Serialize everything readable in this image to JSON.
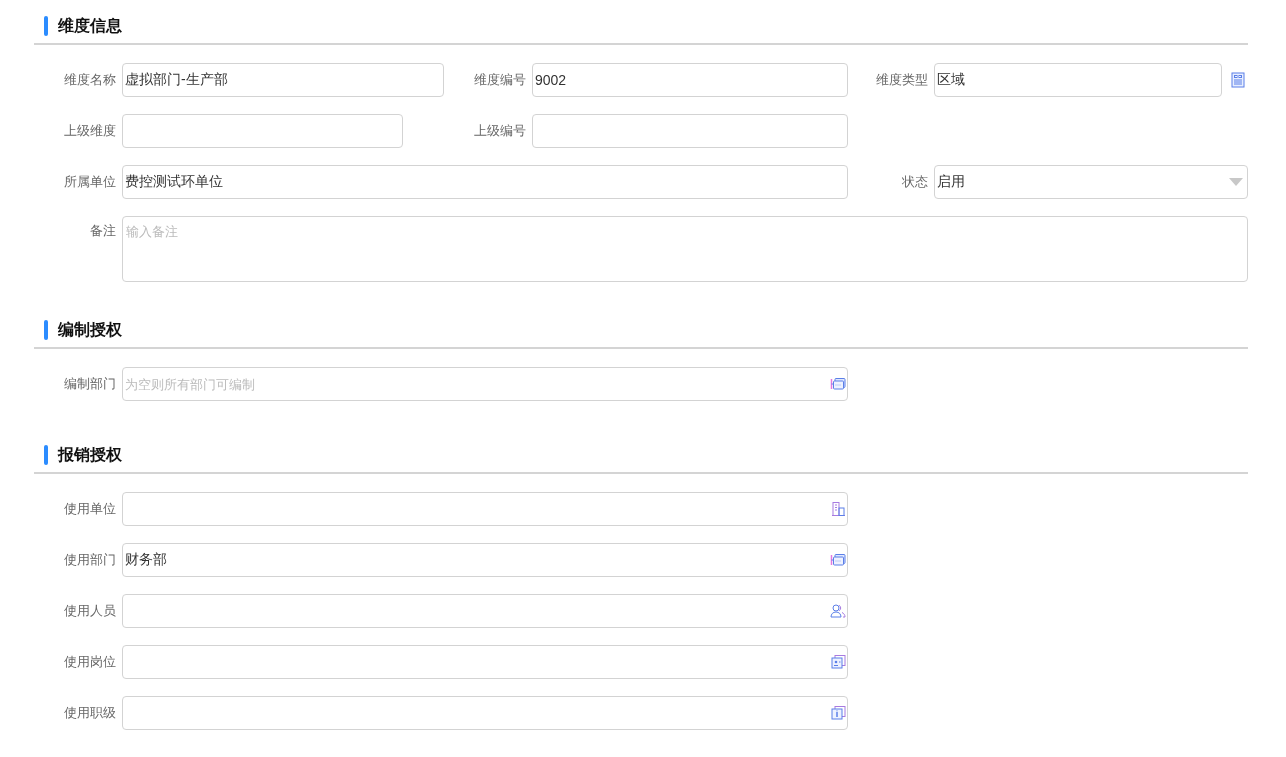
{
  "sections": [
    {
      "title": "维度信息",
      "fields": [
        {
          "label": "维度名称",
          "kind": "text",
          "value": "虚拟部门-生产部"
        },
        {
          "label": "维度编号",
          "kind": "text",
          "value": "9002"
        },
        {
          "label": "维度类型",
          "kind": "lookup",
          "value": "区域"
        },
        {
          "label": "上级维度",
          "kind": "text"
        },
        {
          "label": "上级编号",
          "kind": "text"
        },
        {
          "label": "所属单位",
          "kind": "text",
          "value": "费控测试环单位"
        },
        {
          "label": "状态",
          "kind": "select",
          "value": "启用"
        },
        {
          "label": "备注",
          "kind": "textarea",
          "placeholder": "输入备注"
        }
      ]
    },
    {
      "title": "编制授权",
      "fields": [
        {
          "label": "编制部门",
          "kind": "dept",
          "placeholder": "为空则所有部门可编制"
        }
      ]
    },
    {
      "title": "报销授权",
      "fields": [
        {
          "label": "使用单位",
          "kind": "unit"
        },
        {
          "label": "使用部门",
          "kind": "dept",
          "value": "财务部"
        },
        {
          "label": "使用人员",
          "kind": "person"
        },
        {
          "label": "使用岗位",
          "kind": "post"
        },
        {
          "label": "使用职级",
          "kind": "rank"
        }
      ]
    }
  ]
}
